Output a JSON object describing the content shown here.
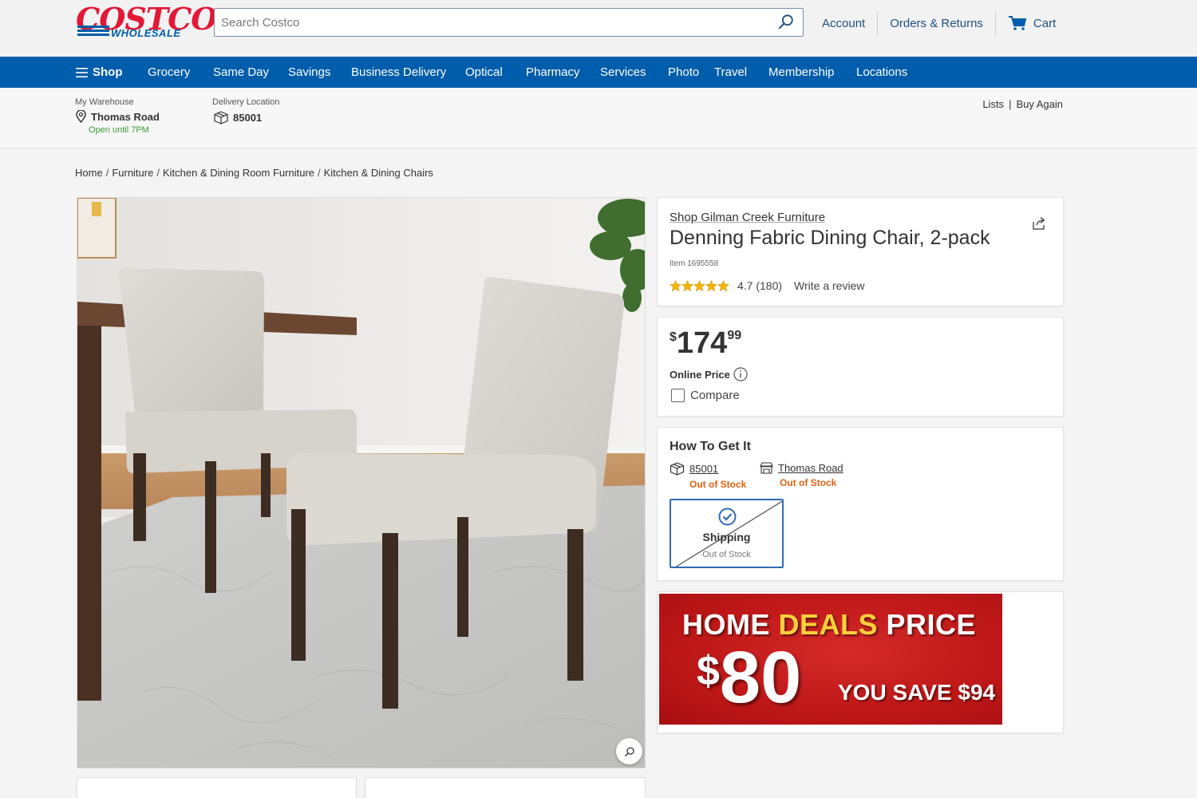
{
  "header": {
    "logo_top": "COSTCO",
    "logo_bottom": "WHOLESALE",
    "search_placeholder": "Search Costco",
    "links": {
      "account": "Account",
      "orders": "Orders & Returns",
      "cart": "Cart"
    }
  },
  "nav": {
    "shop": "Shop",
    "items": [
      "Grocery",
      "Same Day",
      "Savings",
      "Business Delivery",
      "Optical",
      "Pharmacy",
      "Services",
      "Photo",
      "Travel",
      "Membership",
      "Locations"
    ]
  },
  "subbar": {
    "warehouse_label": "My Warehouse",
    "warehouse_name": "Thomas Road",
    "warehouse_hours": "Open until 7PM",
    "delivery_label": "Delivery Location",
    "delivery_zip": "85001",
    "lists": "Lists",
    "lists_sep": "|",
    "buy_again": "Buy Again"
  },
  "breadcrumb": [
    "Home",
    "Furniture",
    "Kitchen & Dining Room Furniture",
    "Kitchen & Dining Chairs"
  ],
  "product": {
    "brand": "Shop Gilman Creek Furniture",
    "title": "Denning Fabric Dining Chair, 2-pack",
    "item_number": "Item 1695558",
    "rating_value": 4.7,
    "rating_text": "4.7 (180)",
    "write_review": "Write a review",
    "price_symbol": "$",
    "price_whole": "174",
    "price_cents": "99",
    "price_label": "Online Price",
    "compare_label": "Compare"
  },
  "fulfillment": {
    "heading": "How To Get It",
    "options": [
      {
        "label": "85001",
        "status": "Out of Stock",
        "icon": "box-icon"
      },
      {
        "label": "Thomas Road",
        "status": "Out of Stock",
        "icon": "store-icon"
      }
    ],
    "shipping_title": "Shipping",
    "shipping_status": "Out of Stock"
  },
  "promo": {
    "word1": "HOME",
    "word2": "DEALS",
    "word3": "PRICE",
    "price_symbol": "$",
    "price": "80",
    "save_text": "YOU SAVE $94"
  },
  "colors": {
    "brand_blue": "#005dab",
    "brand_red": "#e31837",
    "out_of_stock": "#e06010",
    "promo_red": "#c01818",
    "promo_yellow": "#fdd03b",
    "star": "#f5b400"
  }
}
